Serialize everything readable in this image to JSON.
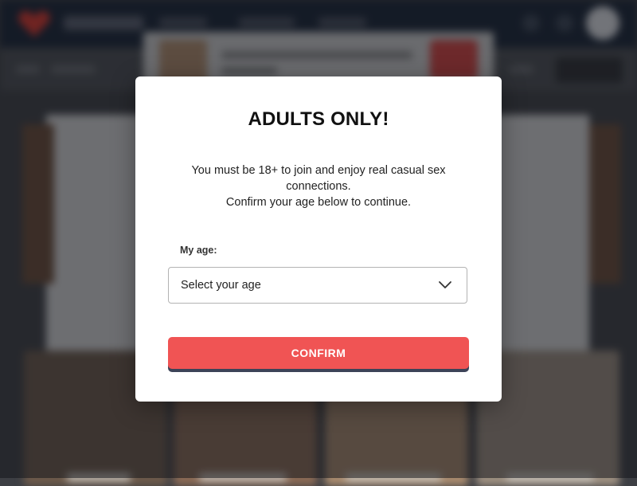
{
  "modal": {
    "title": "ADULTS ONLY!",
    "description_line1": "You must be 18+ to join and enjoy real casual sex",
    "description_line2": "connections.",
    "description_line3": "Confirm your age below to continue.",
    "age_label": "My age:",
    "age_select_value": "Select your age",
    "confirm_label": "CONFIRM"
  },
  "icons": {
    "select_indicator": "chevron-down-icon",
    "logo": "heart-logo-icon"
  },
  "colors": {
    "confirm_button": "#f05454",
    "confirm_shadow": "#3c4358",
    "topbar": "#162234",
    "brand_red": "#e0352b"
  }
}
